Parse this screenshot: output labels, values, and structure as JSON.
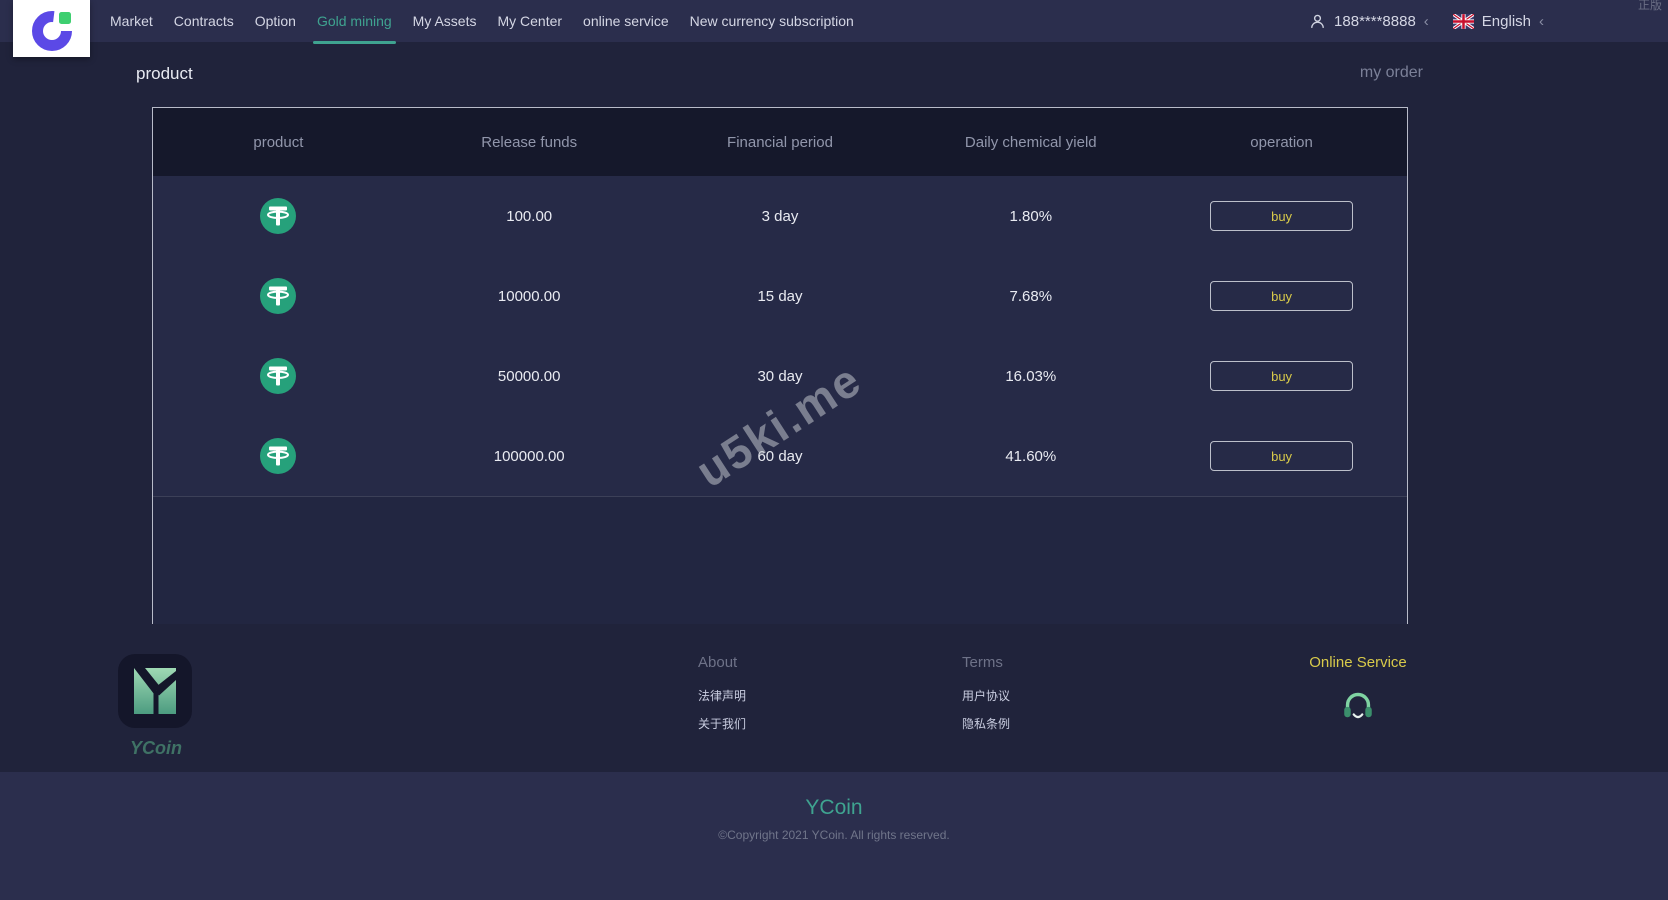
{
  "nav": {
    "items": [
      "Market",
      "Contracts",
      "Option",
      "Gold mining",
      "My Assets",
      "My Center",
      "online service",
      "New currency subscription"
    ],
    "active_item": "Gold mining",
    "user_phone": "188****8888",
    "chevron": "‹",
    "language": "English",
    "corner_tag": "正版"
  },
  "page": {
    "title": "product",
    "my_order_label": "my order"
  },
  "table": {
    "headers": [
      "product",
      "Release funds",
      "Financial period",
      "Daily chemical yield",
      "operation"
    ],
    "rows": [
      {
        "coin": "USDT",
        "release_funds": "100.00",
        "financial_period": "3 day",
        "daily_yield": "1.80%",
        "action": "buy"
      },
      {
        "coin": "USDT",
        "release_funds": "10000.00",
        "financial_period": "15 day",
        "daily_yield": "7.68%",
        "action": "buy"
      },
      {
        "coin": "USDT",
        "release_funds": "50000.00",
        "financial_period": "30 day",
        "daily_yield": "16.03%",
        "action": "buy"
      },
      {
        "coin": "USDT",
        "release_funds": "100000.00",
        "financial_period": "60 day",
        "daily_yield": "41.60%",
        "action": "buy"
      }
    ]
  },
  "watermark": "u5ki.me",
  "footer": {
    "brand": "YCoin",
    "about": {
      "title": "About",
      "links": [
        "法律声明",
        "关于我们"
      ]
    },
    "terms": {
      "title": "Terms",
      "links": [
        "用户协议",
        "隐私条例"
      ]
    },
    "online_service": "Online Service"
  },
  "bottom_bar": {
    "brand": "YCoin",
    "copyright": "©Copyright 2021 YCoin. All rights reserved."
  },
  "colors": {
    "accent_teal": "#3fa390",
    "accent_yellow": "#d8ca4a",
    "tether_green": "#26a17b",
    "topbar_bg": "#2b2e4d",
    "page_bg": "#20233b",
    "table_header_bg": "#15182b",
    "table_row_bg": "#262a47"
  }
}
